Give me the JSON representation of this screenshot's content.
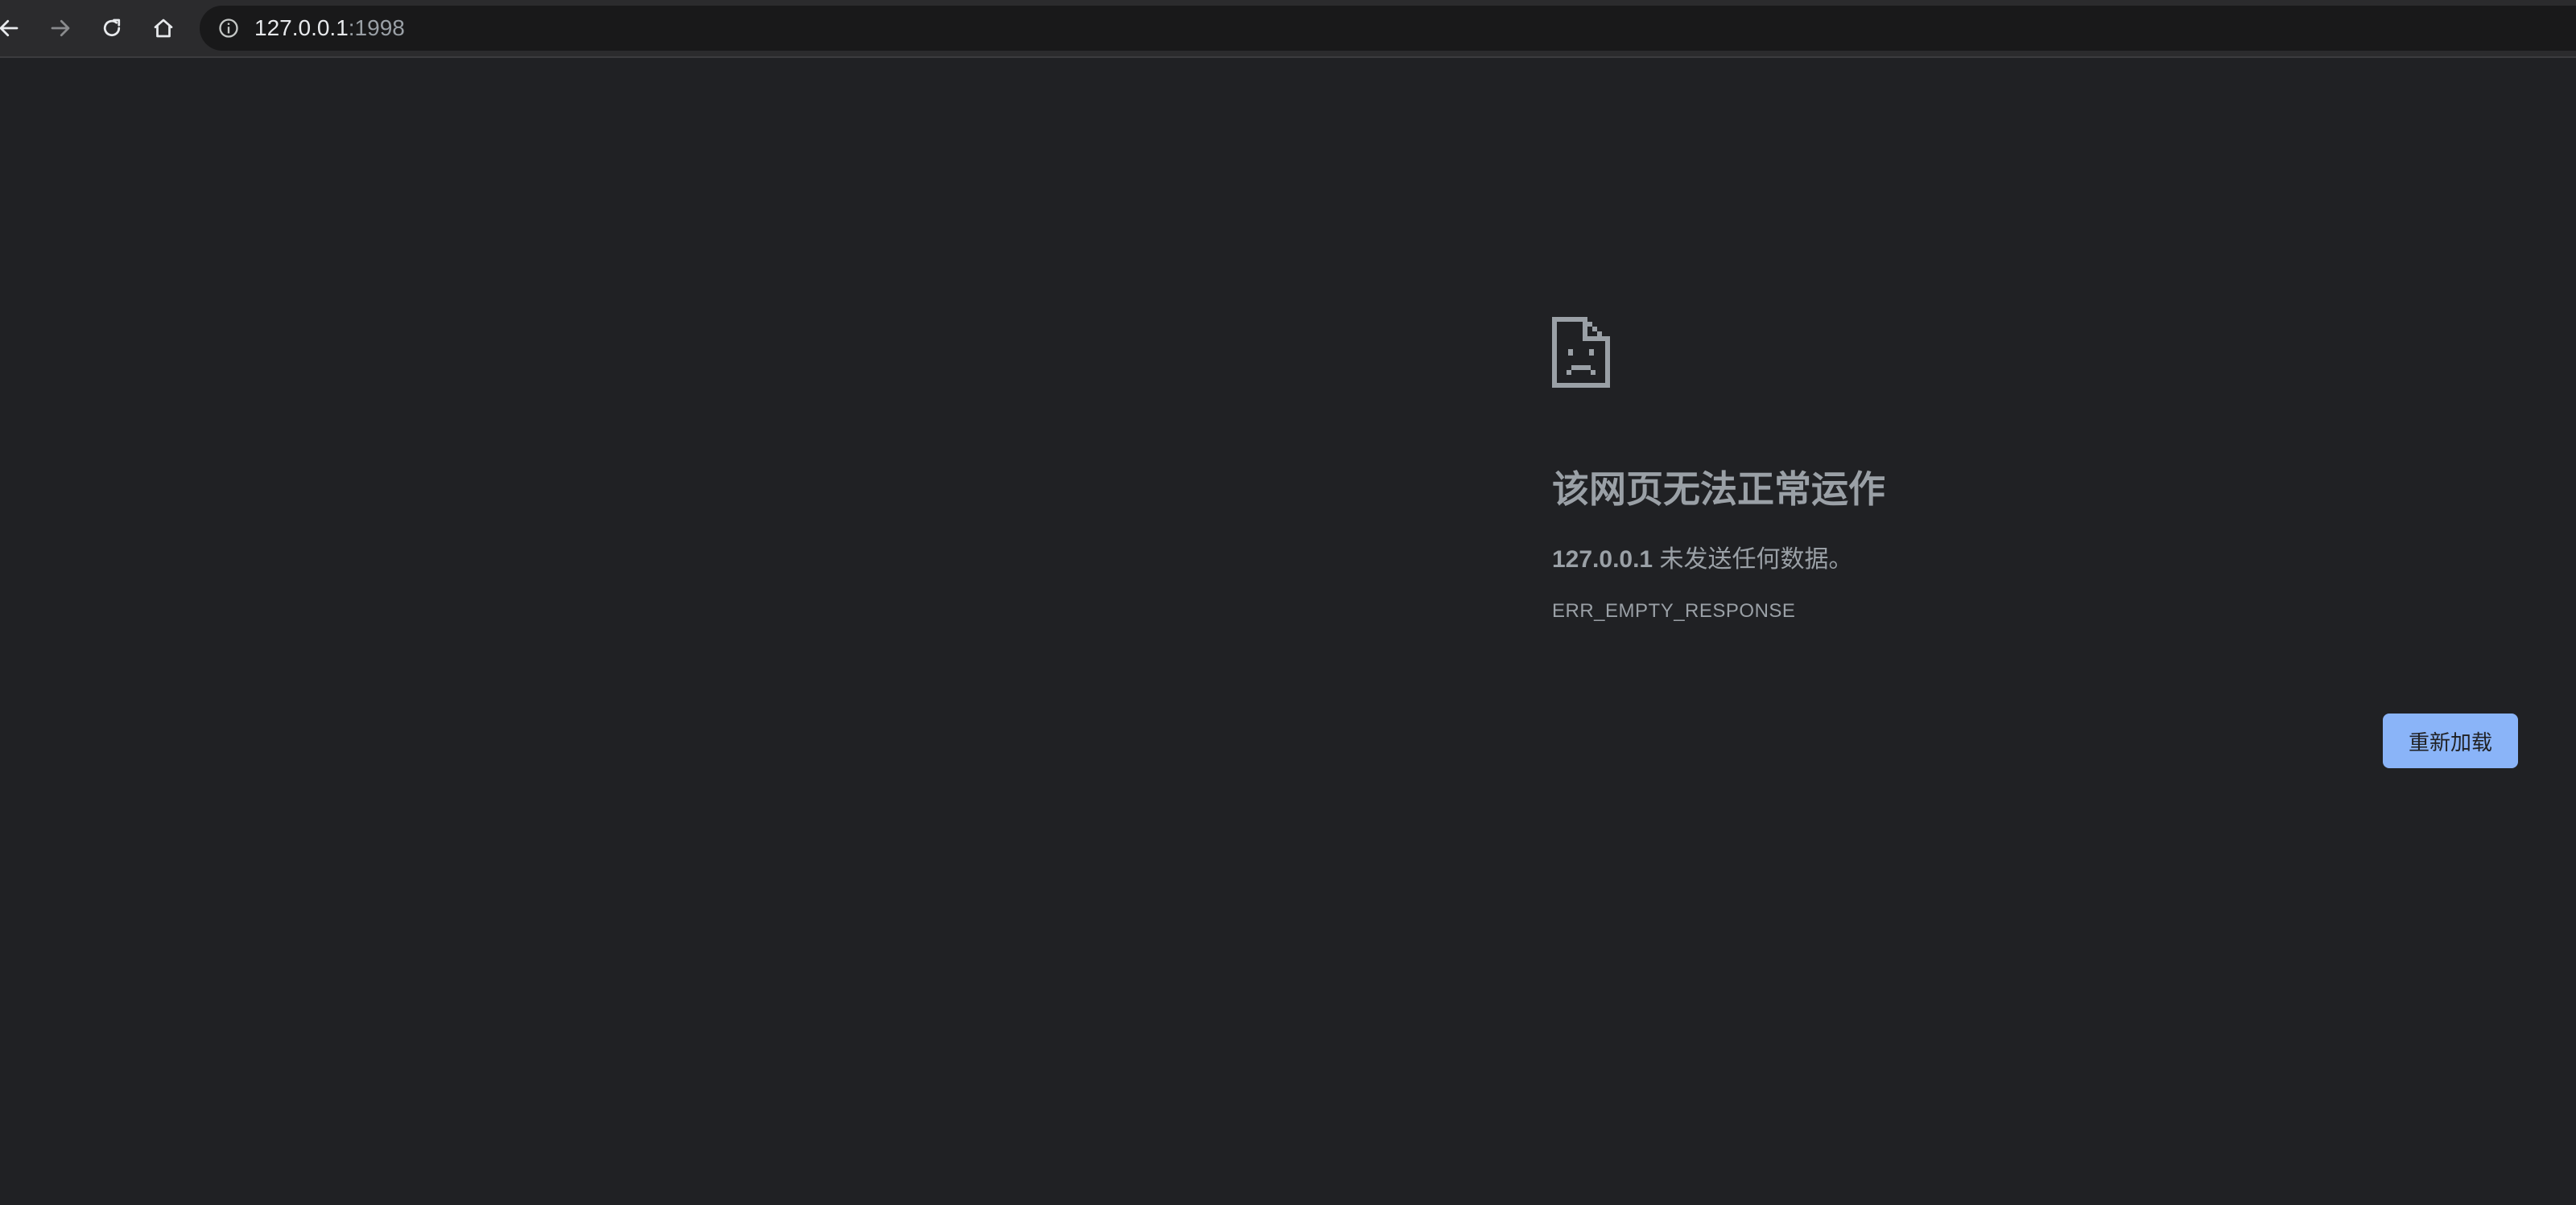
{
  "browser": {
    "address_bar": {
      "host": "127.0.0.1",
      "port": ":1998"
    },
    "icons": {
      "back": "back-arrow-icon",
      "forward": "forward-arrow-icon",
      "reload": "reload-icon",
      "home": "home-icon",
      "site_info": "info-icon"
    }
  },
  "error_page": {
    "icon": "sad-document-icon",
    "title": "该网页无法正常运作",
    "description_host": "127.0.0.1",
    "description_text": " 未发送任何数据。",
    "error_code": "ERR_EMPTY_RESPONSE",
    "reload_label": "重新加载"
  },
  "colors": {
    "background": "#202124",
    "toolbar": "#2b2b2d",
    "omnibox": "#19191a",
    "text_muted": "#9aa0a6",
    "button": "#8ab4f8"
  }
}
